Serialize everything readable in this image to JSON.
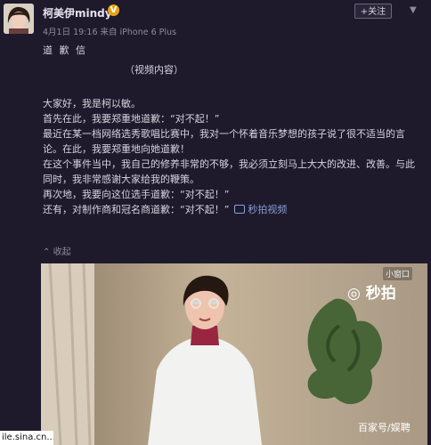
{
  "post": {
    "username": "柯美伊mindy",
    "verified_badge": "V",
    "follow_label": "+关注",
    "meta": "4月1日 19:16 来自 iPhone 6 Plus",
    "title": "道 歉 信",
    "video_note": "（视频内容）",
    "lines": [
      "大家好，我是柯以敏。",
      "首先在此，我要郑重地道歉：“对不起！”",
      "最近在某一档网络选秀歌唱比赛中，我对一个怀着音乐梦想的孩子说了很不适当的言论。在此，我要郑重地向她道歉！",
      "在这个事件当中，我自己的修养非常的不够，我必须立刻马上大大的改进、改善。与此同时，我非常感谢大家给我的鞭策。",
      "再次地，我要向这位选手道歉：“对不起！”",
      "还有，对制作商和冠名商道歉：“对不起！”"
    ],
    "video_link": "秒拍视频",
    "collapse_label": "收起"
  },
  "video": {
    "mini_window_label": "小窗口",
    "logo_text": "秒拍",
    "watermark": "百家号/娱聘"
  },
  "browser": {
    "url_fragment": "ile.sina.cn..."
  },
  "colors": {
    "background": "#1e1a2c",
    "badge": "#e8a310",
    "link": "#8a9ed6"
  }
}
